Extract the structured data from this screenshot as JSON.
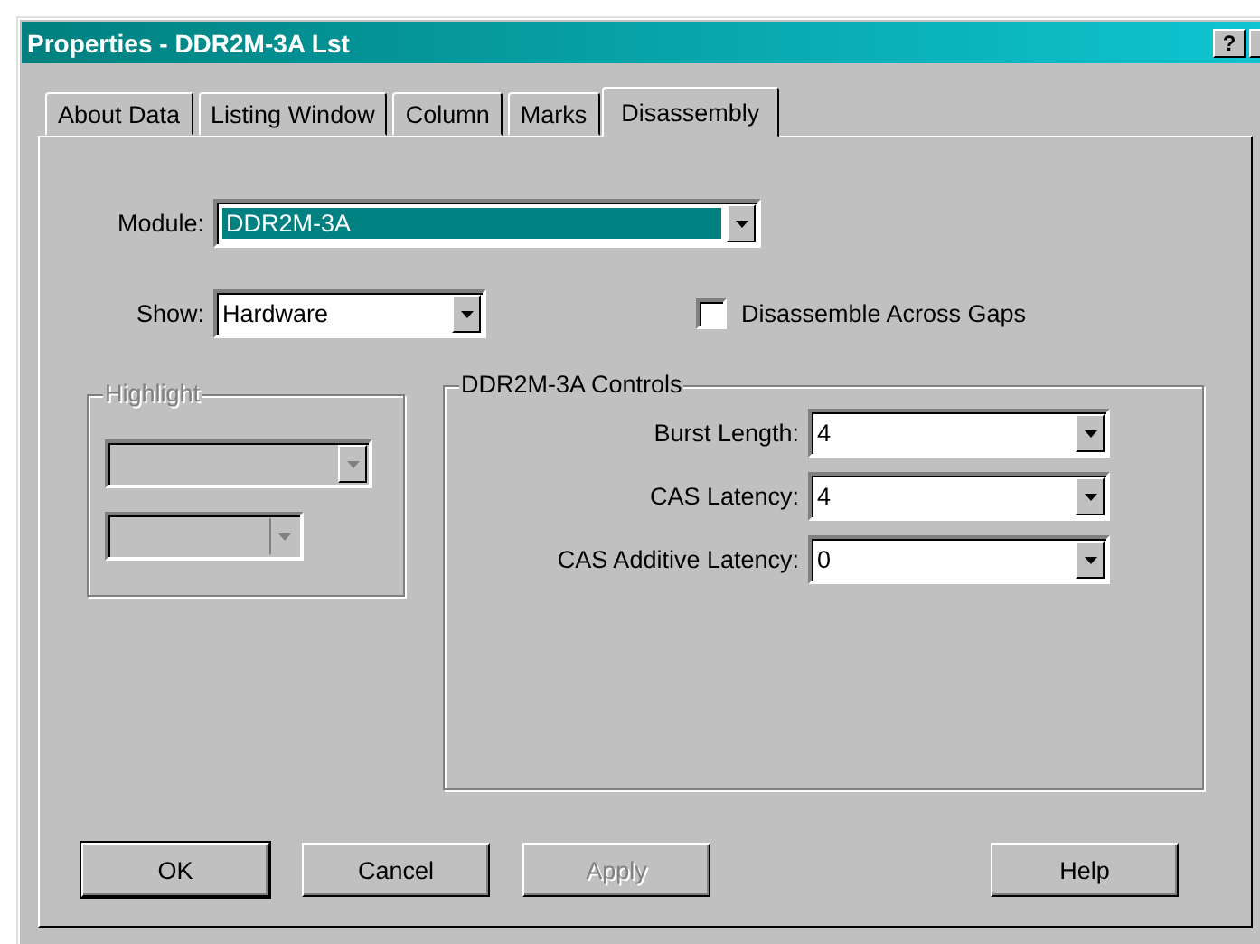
{
  "window": {
    "title": "Properties - DDR2M-3A Lst",
    "help_button": "?"
  },
  "tabs": [
    {
      "label": "About Data",
      "selected": false
    },
    {
      "label": "Listing Window",
      "selected": false
    },
    {
      "label": "Column",
      "selected": false
    },
    {
      "label": "Marks",
      "selected": false
    },
    {
      "label": "Disassembly",
      "selected": true
    }
  ],
  "module": {
    "label": "Module:",
    "value": "DDR2M-3A",
    "focused": true
  },
  "show": {
    "label": "Show:",
    "value": "Hardware",
    "focused": false
  },
  "disassemble_across_gaps": {
    "label": "Disassemble Across Gaps",
    "checked": false
  },
  "highlight": {
    "title": "Highlight",
    "disabled": true
  },
  "controls": {
    "title": "DDR2M-3A Controls",
    "fields": [
      {
        "label": "Burst Length:",
        "value": "4"
      },
      {
        "label": "CAS Latency:",
        "value": "4"
      },
      {
        "label": "CAS Additive Latency:",
        "value": "0"
      }
    ]
  },
  "buttons": [
    {
      "label": "OK",
      "default": true,
      "disabled": false
    },
    {
      "label": "Cancel",
      "default": false,
      "disabled": false
    },
    {
      "label": "Apply",
      "default": false,
      "disabled": true
    },
    {
      "label": "Help",
      "default": false,
      "disabled": false
    }
  ]
}
